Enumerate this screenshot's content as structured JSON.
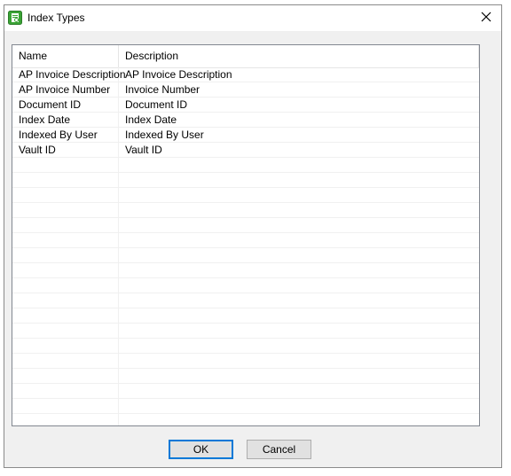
{
  "window": {
    "title": "Index Types",
    "close_label": "✕"
  },
  "list": {
    "columns": [
      "Name",
      "Description"
    ],
    "rows": [
      {
        "name": "AP Invoice Description",
        "description": "AP Invoice Description"
      },
      {
        "name": "AP Invoice Number",
        "description": "Invoice Number"
      },
      {
        "name": "Document ID",
        "description": "Document ID"
      },
      {
        "name": "Index Date",
        "description": "Index Date"
      },
      {
        "name": "Indexed By User",
        "description": "Indexed By User"
      },
      {
        "name": "Vault ID",
        "description": "Vault ID"
      }
    ]
  },
  "buttons": {
    "ok_label": "OK",
    "cancel_label": "Cancel"
  },
  "colors": {
    "accent": "#0078d7",
    "app_icon": "#3aa335"
  }
}
